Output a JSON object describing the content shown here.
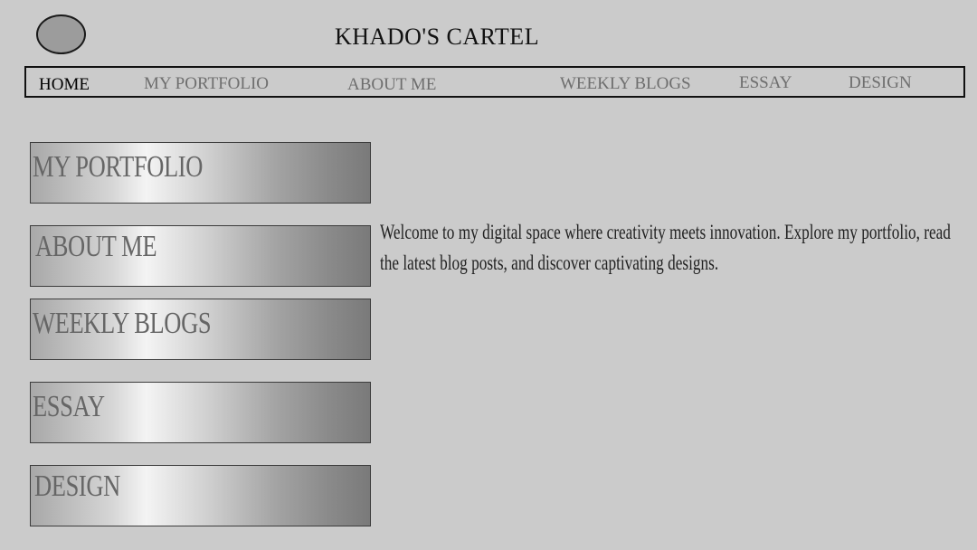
{
  "header": {
    "title": "KHADO'S CARTEL"
  },
  "nav": {
    "items": [
      {
        "label": "HOME",
        "active": true
      },
      {
        "label": "MY PORTFOLIO",
        "active": false
      },
      {
        "label": "ABOUT ME",
        "active": false
      },
      {
        "label": "WEEKLY BLOGS",
        "active": false
      },
      {
        "label": "ESSAY",
        "active": false
      },
      {
        "label": "DESIGN",
        "active": false
      }
    ]
  },
  "sidebar": {
    "buttons": [
      {
        "label": "MY PORTFOLIO"
      },
      {
        "label": "ABOUT ME"
      },
      {
        "label": "WEEKLY BLOGS"
      },
      {
        "label": "ESSAY"
      },
      {
        "label": "DESIGN"
      }
    ]
  },
  "main": {
    "welcome_text": "Welcome to my digital space where creativity meets innovation. Explore my portfolio, read the latest blog posts, and discover captivating designs."
  },
  "colors": {
    "background": "#cbcbcb",
    "nav_text": "#6e6e6e",
    "nav_active_text": "#000000",
    "logo_fill": "#9c9c9c"
  }
}
